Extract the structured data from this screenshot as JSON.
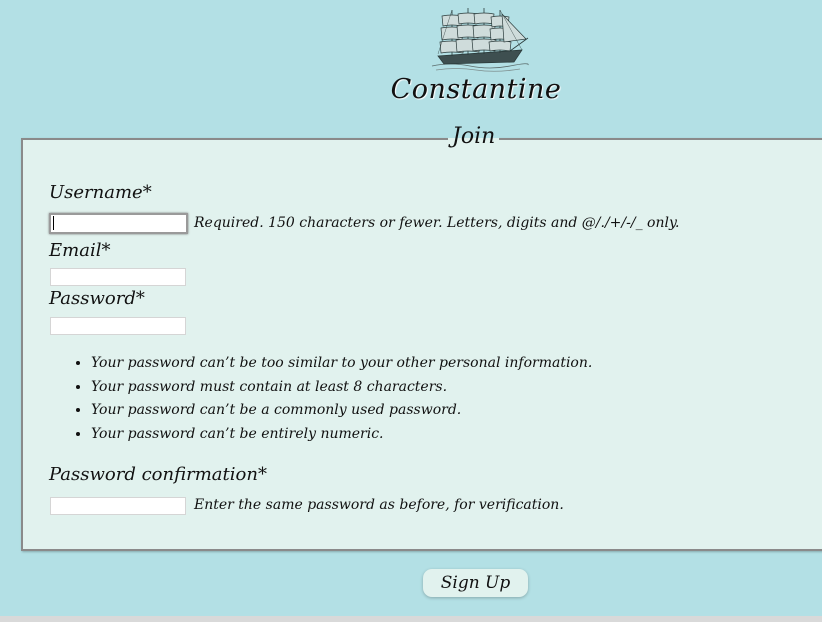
{
  "brand": {
    "name": "Constantine",
    "logo_icon": "sailing-ship-icon"
  },
  "form": {
    "legend": "Join",
    "username": {
      "label": "Username*",
      "value": "",
      "help": "Required. 150 characters or fewer. Letters, digits and @/./+/-/_ only."
    },
    "email": {
      "label": "Email*",
      "value": ""
    },
    "password": {
      "label": "Password*",
      "value": "",
      "rules": [
        "Your password can’t be too similar to your other personal information.",
        "Your password must contain at least 8 characters.",
        "Your password can’t be a commonly used password.",
        "Your password can’t be entirely numeric."
      ]
    },
    "password_confirmation": {
      "label": "Password confirmation*",
      "value": "",
      "help": "Enter the same password as before, for verification."
    },
    "submit_label": "Sign Up"
  },
  "colors": {
    "page_background": "#b3e0e5",
    "panel_background": "#e1f2ee",
    "text": "#111111"
  }
}
